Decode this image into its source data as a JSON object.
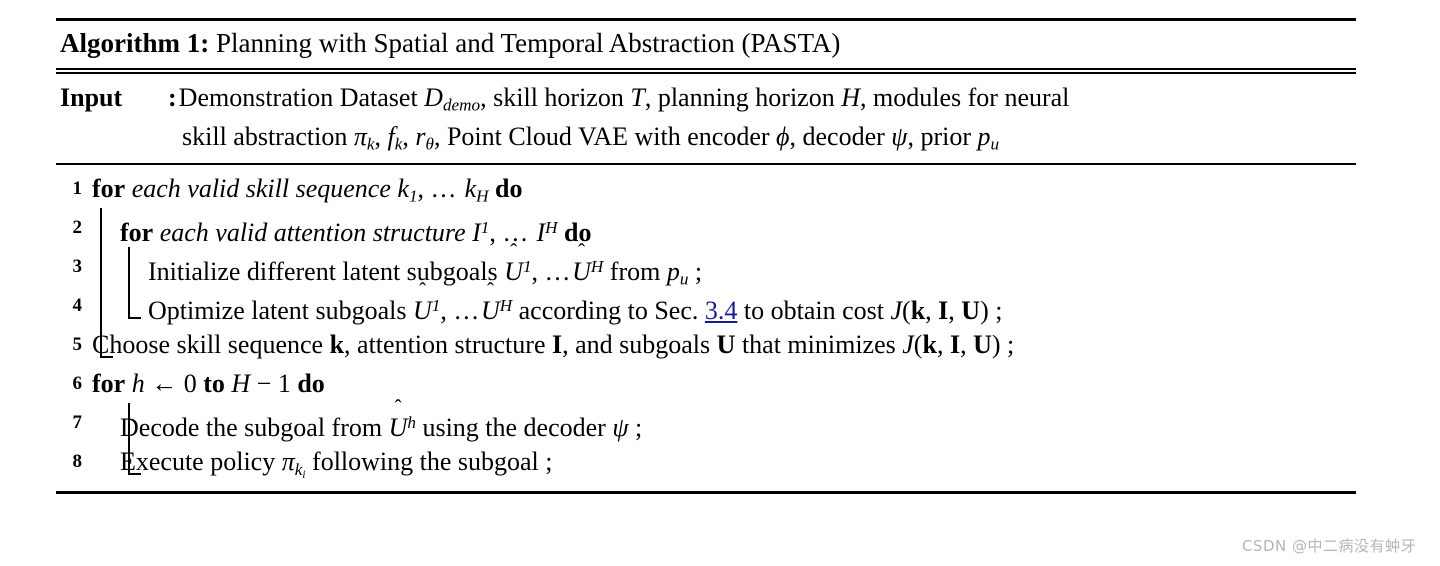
{
  "document": {
    "type": "algorithm-pseudocode-figure",
    "caption": {
      "label": "Algorithm 1:",
      "title": "Planning with Spatial and Temporal Abstraction (PASTA)"
    },
    "input": {
      "label": "Input",
      "colon": ":",
      "line1_a": "Demonstration Dataset ",
      "line1_D": "D",
      "line1_D_sub": "demo",
      "line1_b": ", skill horizon ",
      "line1_T": "T",
      "line1_c": ", planning horizon ",
      "line1_H": "H",
      "line1_d": ", modules for neural",
      "line2_a": "skill abstraction ",
      "line2_pi": "π",
      "line2_pi_sub": "k",
      "line2_b": ", ",
      "line2_f": "f",
      "line2_f_sub": "k",
      "line2_c": ", ",
      "line2_r": "r",
      "line2_r_sub": "θ",
      "line2_d": ", Point Cloud VAE with encoder ",
      "line2_phi": "ϕ",
      "line2_e": ", decoder ",
      "line2_psi": "ψ",
      "line2_f2": ", prior ",
      "line2_p": "p",
      "line2_p_sub": "u"
    },
    "steps": [
      {
        "number": "1",
        "indent": 0,
        "parts": [
          {
            "t": "kw",
            "v": "for"
          },
          {
            "t": "sp",
            "v": " "
          },
          {
            "t": "it",
            "v": "each valid skill sequence"
          },
          {
            "t": "sp",
            "v": " "
          },
          {
            "t": "var",
            "v": "k"
          },
          {
            "t": "sub",
            "v": "1"
          },
          {
            "t": "txt",
            "v": ", "
          },
          {
            "t": "dots",
            "v": "…"
          },
          {
            "t": "sp",
            "v": " "
          },
          {
            "t": "var",
            "v": "k"
          },
          {
            "t": "sub",
            "v": "H"
          },
          {
            "t": "sp",
            "v": " "
          },
          {
            "t": "kw",
            "v": "do"
          }
        ]
      },
      {
        "number": "2",
        "indent": 1,
        "parts": [
          {
            "t": "kw",
            "v": "for"
          },
          {
            "t": "sp",
            "v": " "
          },
          {
            "t": "it",
            "v": "each valid attention structure"
          },
          {
            "t": "sp",
            "v": " "
          },
          {
            "t": "var",
            "v": "I"
          },
          {
            "t": "sup",
            "v": "1"
          },
          {
            "t": "txt",
            "v": ", "
          },
          {
            "t": "dots",
            "v": "…"
          },
          {
            "t": "sp",
            "v": " "
          },
          {
            "t": "var",
            "v": "I"
          },
          {
            "t": "sup",
            "v": "H"
          },
          {
            "t": "sp",
            "v": " "
          },
          {
            "t": "kw",
            "v": "do"
          }
        ]
      },
      {
        "number": "3",
        "indent": 2,
        "parts": [
          {
            "t": "txt",
            "v": "Initialize different latent subgoals "
          },
          {
            "t": "hatvar",
            "v": "U"
          },
          {
            "t": "sup",
            "v": "1"
          },
          {
            "t": "txt",
            "v": ", "
          },
          {
            "t": "dots",
            "v": "…"
          },
          {
            "t": "hatvar",
            "v": "U"
          },
          {
            "t": "sup",
            "v": "H"
          },
          {
            "t": "txt",
            "v": " from "
          },
          {
            "t": "var",
            "v": "p"
          },
          {
            "t": "sub",
            "v": "u"
          },
          {
            "t": "txt",
            "v": " ;"
          }
        ]
      },
      {
        "number": "4",
        "indent": 2,
        "parts": [
          {
            "t": "txt",
            "v": "Optimize latent subgoals "
          },
          {
            "t": "hatvar",
            "v": "U"
          },
          {
            "t": "sup",
            "v": "1"
          },
          {
            "t": "txt",
            "v": ", "
          },
          {
            "t": "dots",
            "v": "…"
          },
          {
            "t": "hatvar",
            "v": "U"
          },
          {
            "t": "sup",
            "v": "H"
          },
          {
            "t": "txt",
            "v": " according to Sec. "
          },
          {
            "t": "link",
            "v": "3.4"
          },
          {
            "t": "txt",
            "v": " to obtain cost "
          },
          {
            "t": "var",
            "v": "J"
          },
          {
            "t": "up",
            "v": "("
          },
          {
            "t": "bf",
            "v": "k"
          },
          {
            "t": "up",
            "v": ", "
          },
          {
            "t": "bf",
            "v": "I"
          },
          {
            "t": "up",
            "v": ", "
          },
          {
            "t": "bf",
            "v": "U"
          },
          {
            "t": "up",
            "v": ")"
          },
          {
            "t": "txt",
            "v": " ;"
          }
        ]
      },
      {
        "number": "5",
        "indent": 0,
        "parts": [
          {
            "t": "txt",
            "v": "Choose skill sequence "
          },
          {
            "t": "bf",
            "v": "k"
          },
          {
            "t": "txt",
            "v": ", attention structure "
          },
          {
            "t": "bf",
            "v": "I"
          },
          {
            "t": "txt",
            "v": ", and subgoals "
          },
          {
            "t": "bf",
            "v": "U"
          },
          {
            "t": "txt",
            "v": " that minimizes "
          },
          {
            "t": "var",
            "v": "J"
          },
          {
            "t": "up",
            "v": "("
          },
          {
            "t": "bf",
            "v": "k"
          },
          {
            "t": "up",
            "v": ", "
          },
          {
            "t": "bf",
            "v": "I"
          },
          {
            "t": "up",
            "v": ", "
          },
          {
            "t": "bf",
            "v": "U"
          },
          {
            "t": "up",
            "v": ")"
          },
          {
            "t": "txt",
            "v": " ;"
          }
        ]
      },
      {
        "number": "6",
        "indent": 0,
        "parts": [
          {
            "t": "kw",
            "v": "for"
          },
          {
            "t": "sp",
            "v": " "
          },
          {
            "t": "var",
            "v": "h"
          },
          {
            "t": "up",
            "v": " ← 0 "
          },
          {
            "t": "kw",
            "v": "to"
          },
          {
            "t": "sp",
            "v": " "
          },
          {
            "t": "var",
            "v": "H"
          },
          {
            "t": "up",
            "v": " − 1 "
          },
          {
            "t": "kw",
            "v": "do"
          }
        ]
      },
      {
        "number": "7",
        "indent": 1,
        "parts": [
          {
            "t": "txt",
            "v": "Decode the subgoal from "
          },
          {
            "t": "hatvar",
            "v": "U"
          },
          {
            "t": "sup",
            "v": "h"
          },
          {
            "t": "txt",
            "v": " using the decoder "
          },
          {
            "t": "var",
            "v": "ψ"
          },
          {
            "t": "txt",
            "v": " ;"
          }
        ]
      },
      {
        "number": "8",
        "indent": 1,
        "parts": [
          {
            "t": "txt",
            "v": "Execute policy "
          },
          {
            "t": "var",
            "v": "π"
          },
          {
            "t": "subsub",
            "v": "k",
            "v2": "i"
          },
          {
            "t": "txt",
            "v": " following the subgoal ;"
          }
        ]
      }
    ],
    "watermark": "CSDN @中二病没有蚛牙"
  }
}
